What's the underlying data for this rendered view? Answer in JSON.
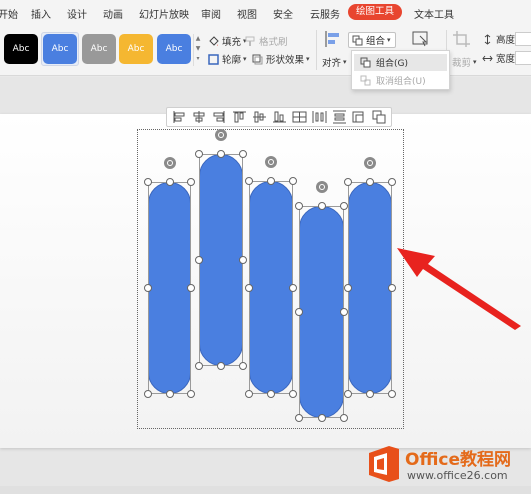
{
  "menu": {
    "tabs": [
      "开始",
      "插入",
      "设计",
      "动画",
      "幻灯片放映",
      "审阅",
      "视图",
      "安全",
      "云服务",
      "绘图工具",
      "文本工具"
    ],
    "active_tab": "绘图工具"
  },
  "ribbon": {
    "style_presets": [
      {
        "label": "Abc",
        "color": "#000000"
      },
      {
        "label": "Abc",
        "color": "#4a7fe0"
      },
      {
        "label": "Abc",
        "color": "#999999"
      },
      {
        "label": "Abc",
        "color": "#f5b731"
      },
      {
        "label": "Abc",
        "color": "#4a7fe0"
      }
    ],
    "fill_label": "填充",
    "format_brush_label": "格式刷",
    "outline_label": "轮廓",
    "shape_effects_label": "形状效果",
    "align_label": "对齐",
    "group_label": "组合",
    "crop_label": "裁剪",
    "height_label": "高度:",
    "width_label": "宽度:"
  },
  "group_menu": {
    "items": [
      {
        "label": "组合(G)",
        "enabled": true
      },
      {
        "label": "取消组合(U)",
        "enabled": false
      }
    ]
  },
  "watermark": {
    "title": "Office教程网",
    "url": "www.office26.com"
  },
  "colors": {
    "accent": "#e8452f",
    "shape_fill": "#4a7fe0",
    "arrow": "#e8231f"
  }
}
